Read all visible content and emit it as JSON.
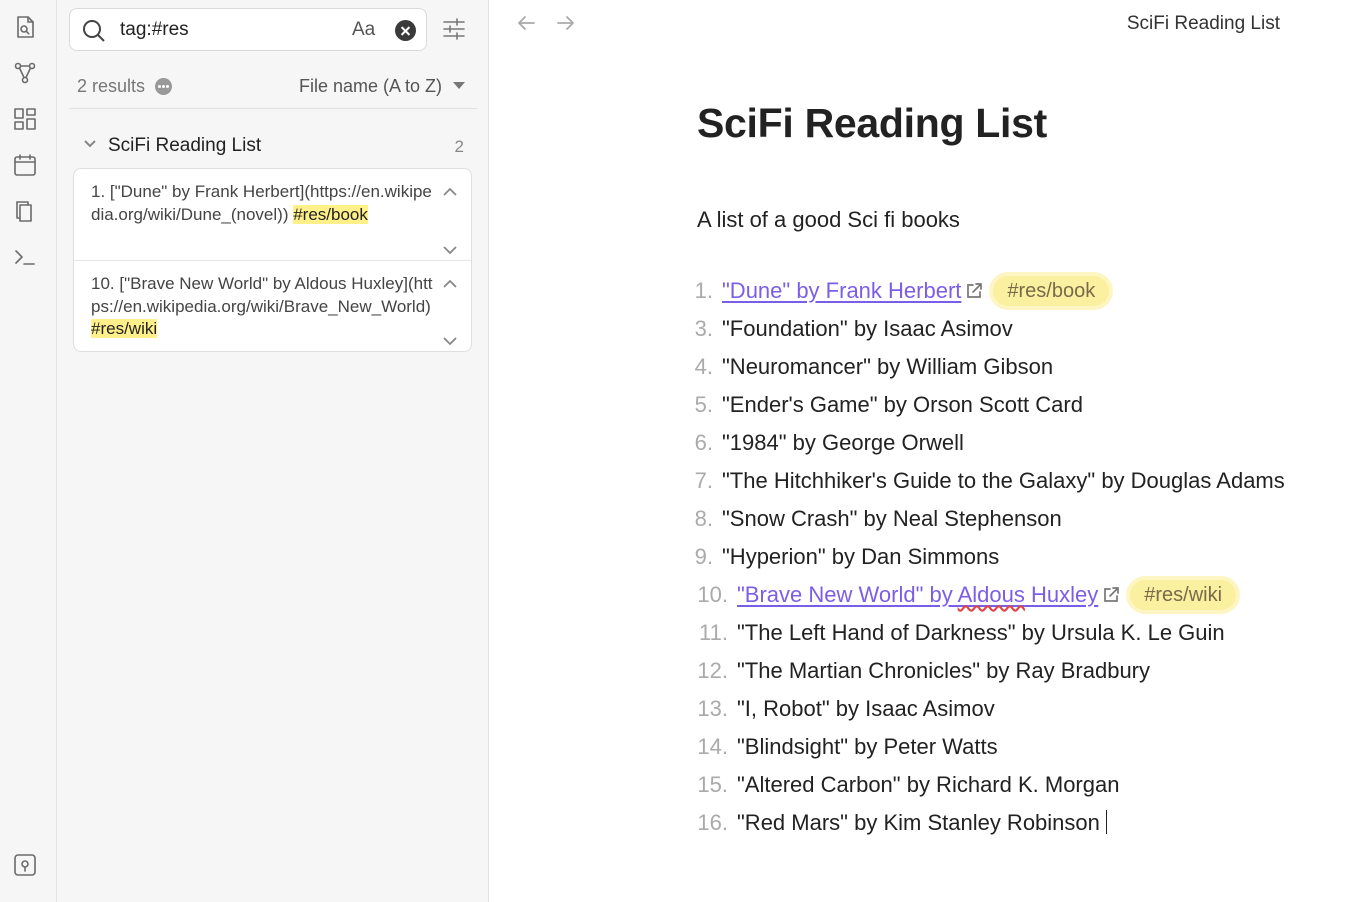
{
  "ribbon": {
    "icons": [
      "search-note-icon",
      "graph-icon",
      "dashboard-icon",
      "calendar-icon",
      "files-icon",
      "terminal-icon",
      "vault-icon"
    ]
  },
  "search": {
    "query": "tag:#res",
    "match_case_label": "Aa",
    "result_count": "2 results",
    "sort_label": "File name (A to Z)",
    "file": {
      "title": "SciFi Reading List",
      "count": "2"
    },
    "matches": [
      {
        "text": "1. [\"Dune\" by Frank Herbert](https://en.wikipedia.org/wiki/Dune_(novel)) ",
        "tag": "#res/book"
      },
      {
        "text": "10. [\"Brave New World\" by Aldous Huxley](https://en.wikipedia.org/wiki/Brave_New_World) ",
        "tag": "#res/wiki"
      }
    ]
  },
  "editor": {
    "tab_title": "SciFi Reading List",
    "title": "SciFi Reading List",
    "description": "A list of a good Sci fi books",
    "items": [
      {
        "num": "1.",
        "text": "\"Dune\" by Frank Herbert",
        "tag": "#res/book",
        "is_link": true
      },
      {
        "num": "3.",
        "text": "\"Foundation\" by Isaac Asimov"
      },
      {
        "num": "4.",
        "text": "\"Neuromancer\" by William Gibson"
      },
      {
        "num": "5.",
        "text": "\"Ender's Game\" by Orson Scott Card"
      },
      {
        "num": "6.",
        "text": "\"1984\" by George Orwell"
      },
      {
        "num": "7.",
        "text": "\"The Hitchhiker's Guide to the Galaxy\" by Douglas Adams"
      },
      {
        "num": "8.",
        "text": "\"Snow Crash\" by Neal Stephenson"
      },
      {
        "num": "9.",
        "text": "\"Hyperion\" by Dan Simmons"
      },
      {
        "num": "10.",
        "text_a": "\"Brave New World\" by ",
        "text_b": "Aldous",
        "text_c": " Huxley",
        "tag": "#res/wiki",
        "is_link": true
      },
      {
        "num": "11.",
        "text": "\"The Left Hand of Darkness\" by Ursula K. Le Guin"
      },
      {
        "num": "12.",
        "text": "\"The Martian Chronicles\" by Ray Bradbury"
      },
      {
        "num": "13.",
        "text": "\"I, Robot\" by Isaac Asimov"
      },
      {
        "num": "14.",
        "text": "\"Blindsight\" by Peter Watts"
      },
      {
        "num": "15.",
        "text": "\"Altered Carbon\" by Richard K. Morgan"
      },
      {
        "num": "16.",
        "text": "\"Red Mars\" by Kim Stanley Robinson"
      }
    ]
  },
  "colors": {
    "link": "#7b5ee8",
    "tag_bg": "#faf0a0",
    "search_highlight": "#fff08a"
  }
}
